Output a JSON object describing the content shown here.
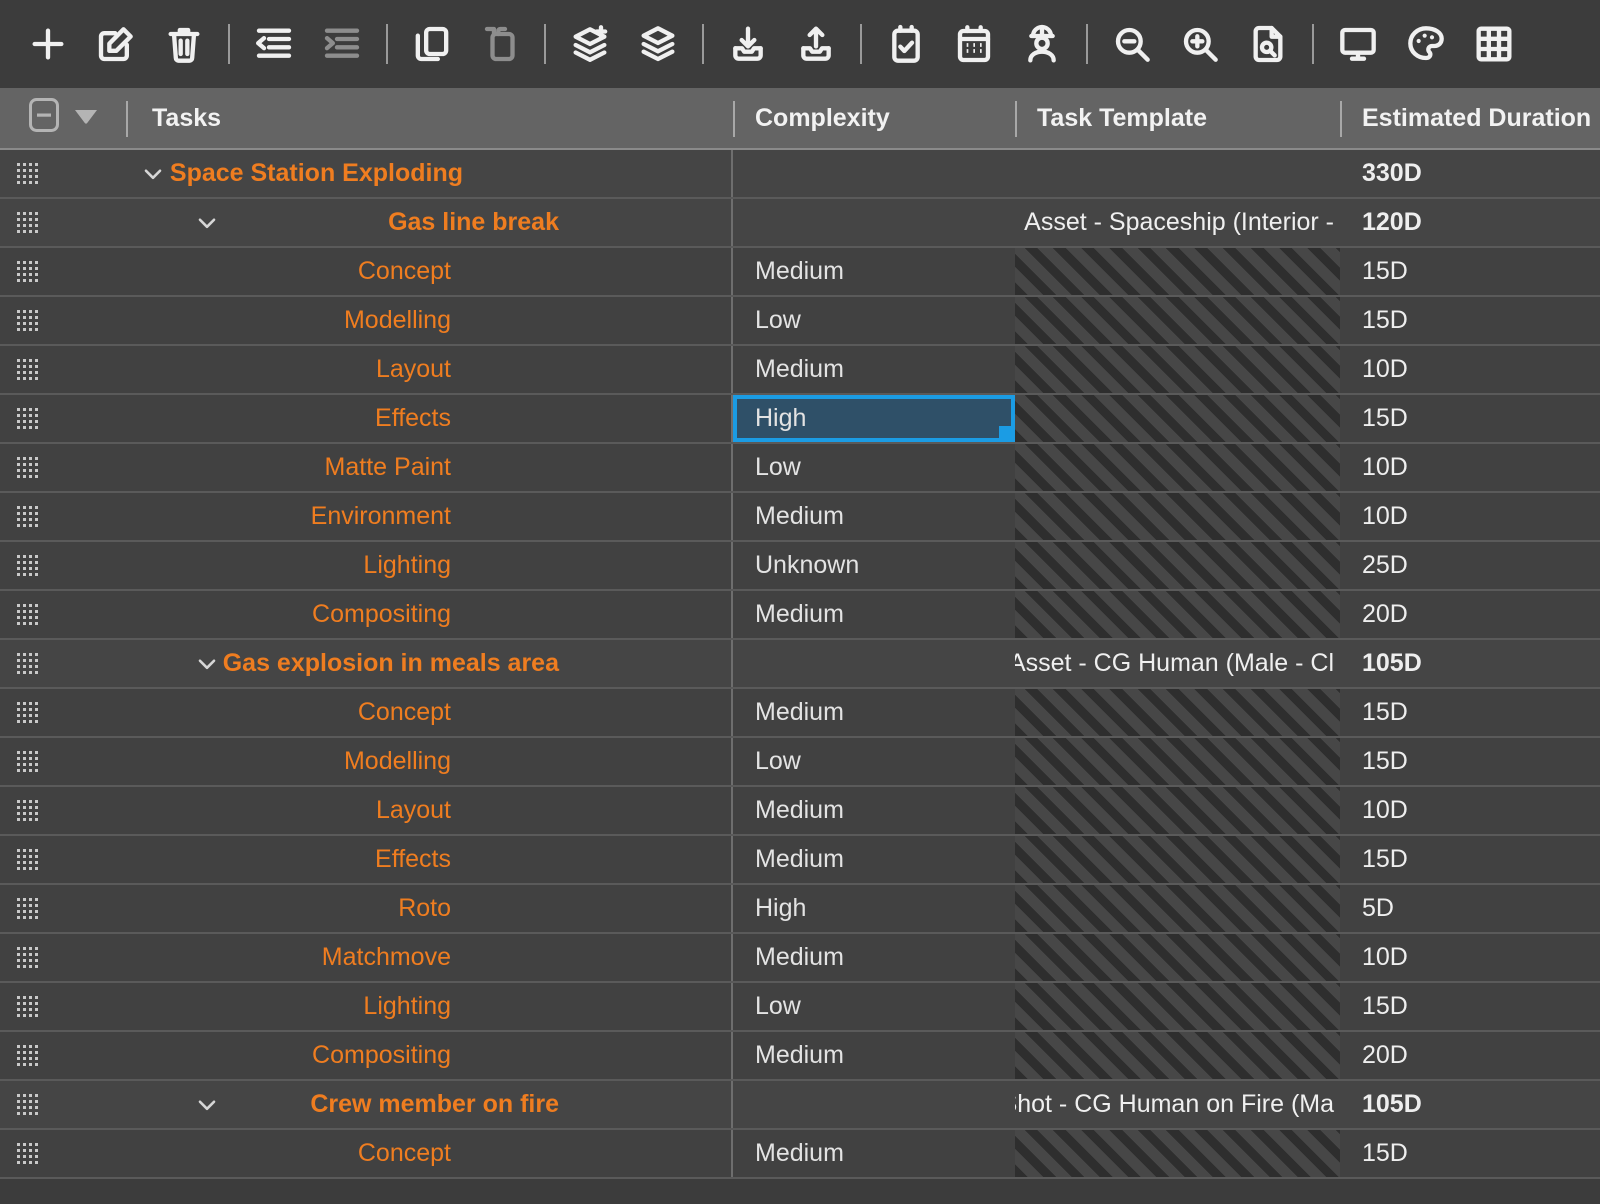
{
  "toolbar": {
    "groups": [
      {
        "items": [
          {
            "name": "add-icon",
            "glyph": "plus",
            "dim": false
          },
          {
            "name": "edit-icon",
            "glyph": "pencil-square",
            "dim": false
          },
          {
            "name": "delete-icon",
            "glyph": "trash",
            "dim": false
          }
        ]
      },
      {
        "items": [
          {
            "name": "outdent-icon",
            "glyph": "outdent",
            "dim": false
          },
          {
            "name": "indent-icon",
            "glyph": "indent",
            "dim": true
          }
        ]
      },
      {
        "items": [
          {
            "name": "copy-icon",
            "glyph": "copy",
            "dim": false
          },
          {
            "name": "paste-icon",
            "glyph": "paste",
            "dim": true
          }
        ]
      },
      {
        "items": [
          {
            "name": "add-layer-icon",
            "glyph": "layer-add",
            "dim": false
          },
          {
            "name": "layers-icon",
            "glyph": "layers",
            "dim": false
          }
        ]
      },
      {
        "items": [
          {
            "name": "import-icon",
            "glyph": "download-tray",
            "dim": false
          },
          {
            "name": "export-icon",
            "glyph": "upload-tray",
            "dim": false
          }
        ]
      },
      {
        "items": [
          {
            "name": "task-checklist-icon",
            "glyph": "clipboard-check",
            "dim": false
          },
          {
            "name": "calendar-icon",
            "glyph": "calendar",
            "dim": false
          },
          {
            "name": "crew-icon",
            "glyph": "person-helmet",
            "dim": false
          }
        ]
      },
      {
        "items": [
          {
            "name": "zoom-out-icon",
            "glyph": "zoom-out",
            "dim": false
          },
          {
            "name": "zoom-in-icon",
            "glyph": "zoom-in",
            "dim": false
          },
          {
            "name": "inspect-document-icon",
            "glyph": "doc-search",
            "dim": false
          }
        ]
      },
      {
        "items": [
          {
            "name": "display-icon",
            "glyph": "monitor",
            "dim": false
          },
          {
            "name": "palette-icon",
            "glyph": "palette",
            "dim": false
          },
          {
            "name": "grid-view-icon",
            "glyph": "grid",
            "dim": false
          }
        ]
      }
    ]
  },
  "header": {
    "collapse_all_label": "",
    "columns": [
      {
        "key": "tasks",
        "label": "Tasks"
      },
      {
        "key": "complexity",
        "label": "Complexity"
      },
      {
        "key": "template",
        "label": "Task Template"
      },
      {
        "key": "duration",
        "label": "Estimated Duration"
      }
    ]
  },
  "colors": {
    "task_text": "#ef7d20",
    "selection_border": "#1b9ce4",
    "selection_fill": "#2f5068",
    "header_bg": "#646464",
    "row_bg": "#414141",
    "group_row_bg": "#454545"
  },
  "rows": [
    {
      "level": 0,
      "expanded": true,
      "group": true,
      "task": "Space Station Exploding",
      "complexity": "",
      "template": "",
      "duration": "330D",
      "hatched": false,
      "selected": false
    },
    {
      "level": 1,
      "expanded": true,
      "group": true,
      "task": "Gas line break",
      "complexity": "",
      "template": "Asset - Spaceship (Interior -",
      "duration": "120D",
      "hatched": false,
      "selected": false
    },
    {
      "level": 2,
      "expanded": false,
      "group": false,
      "task": "Concept",
      "complexity": "Medium",
      "template": "",
      "duration": "15D",
      "hatched": true,
      "selected": false
    },
    {
      "level": 2,
      "expanded": false,
      "group": false,
      "task": "Modelling",
      "complexity": "Low",
      "template": "",
      "duration": "15D",
      "hatched": true,
      "selected": false
    },
    {
      "level": 2,
      "expanded": false,
      "group": false,
      "task": "Layout",
      "complexity": "Medium",
      "template": "",
      "duration": "10D",
      "hatched": true,
      "selected": false
    },
    {
      "level": 2,
      "expanded": false,
      "group": false,
      "task": "Effects",
      "complexity": "High",
      "template": "",
      "duration": "15D",
      "hatched": true,
      "selected": true
    },
    {
      "level": 2,
      "expanded": false,
      "group": false,
      "task": "Matte Paint",
      "complexity": "Low",
      "template": "",
      "duration": "10D",
      "hatched": true,
      "selected": false
    },
    {
      "level": 2,
      "expanded": false,
      "group": false,
      "task": "Environment",
      "complexity": "Medium",
      "template": "",
      "duration": "10D",
      "hatched": true,
      "selected": false
    },
    {
      "level": 2,
      "expanded": false,
      "group": false,
      "task": "Lighting",
      "complexity": "Unknown",
      "template": "",
      "duration": "25D",
      "hatched": true,
      "selected": false
    },
    {
      "level": 2,
      "expanded": false,
      "group": false,
      "task": "Compositing",
      "complexity": "Medium",
      "template": "",
      "duration": "20D",
      "hatched": true,
      "selected": false
    },
    {
      "level": 1,
      "expanded": true,
      "group": true,
      "task": "Gas explosion in meals area",
      "complexity": "",
      "template": "Asset - CG Human (Male - Cl",
      "duration": "105D",
      "hatched": false,
      "selected": false
    },
    {
      "level": 2,
      "expanded": false,
      "group": false,
      "task": "Concept",
      "complexity": "Medium",
      "template": "",
      "duration": "15D",
      "hatched": true,
      "selected": false
    },
    {
      "level": 2,
      "expanded": false,
      "group": false,
      "task": "Modelling",
      "complexity": "Low",
      "template": "",
      "duration": "15D",
      "hatched": true,
      "selected": false
    },
    {
      "level": 2,
      "expanded": false,
      "group": false,
      "task": "Layout",
      "complexity": "Medium",
      "template": "",
      "duration": "10D",
      "hatched": true,
      "selected": false
    },
    {
      "level": 2,
      "expanded": false,
      "group": false,
      "task": "Effects",
      "complexity": "Medium",
      "template": "",
      "duration": "15D",
      "hatched": true,
      "selected": false
    },
    {
      "level": 2,
      "expanded": false,
      "group": false,
      "task": "Roto",
      "complexity": "High",
      "template": "",
      "duration": "5D",
      "hatched": true,
      "selected": false
    },
    {
      "level": 2,
      "expanded": false,
      "group": false,
      "task": "Matchmove",
      "complexity": "Medium",
      "template": "",
      "duration": "10D",
      "hatched": true,
      "selected": false
    },
    {
      "level": 2,
      "expanded": false,
      "group": false,
      "task": "Lighting",
      "complexity": "Low",
      "template": "",
      "duration": "15D",
      "hatched": true,
      "selected": false
    },
    {
      "level": 2,
      "expanded": false,
      "group": false,
      "task": "Compositing",
      "complexity": "Medium",
      "template": "",
      "duration": "20D",
      "hatched": true,
      "selected": false
    },
    {
      "level": 1,
      "expanded": true,
      "group": true,
      "task": "Crew member on fire",
      "complexity": "",
      "template": "Shot - CG Human on Fire (Ma",
      "duration": "105D",
      "hatched": false,
      "selected": false
    },
    {
      "level": 2,
      "expanded": false,
      "group": false,
      "task": "Concept",
      "complexity": "Medium",
      "template": "",
      "duration": "15D",
      "hatched": true,
      "selected": false
    }
  ]
}
